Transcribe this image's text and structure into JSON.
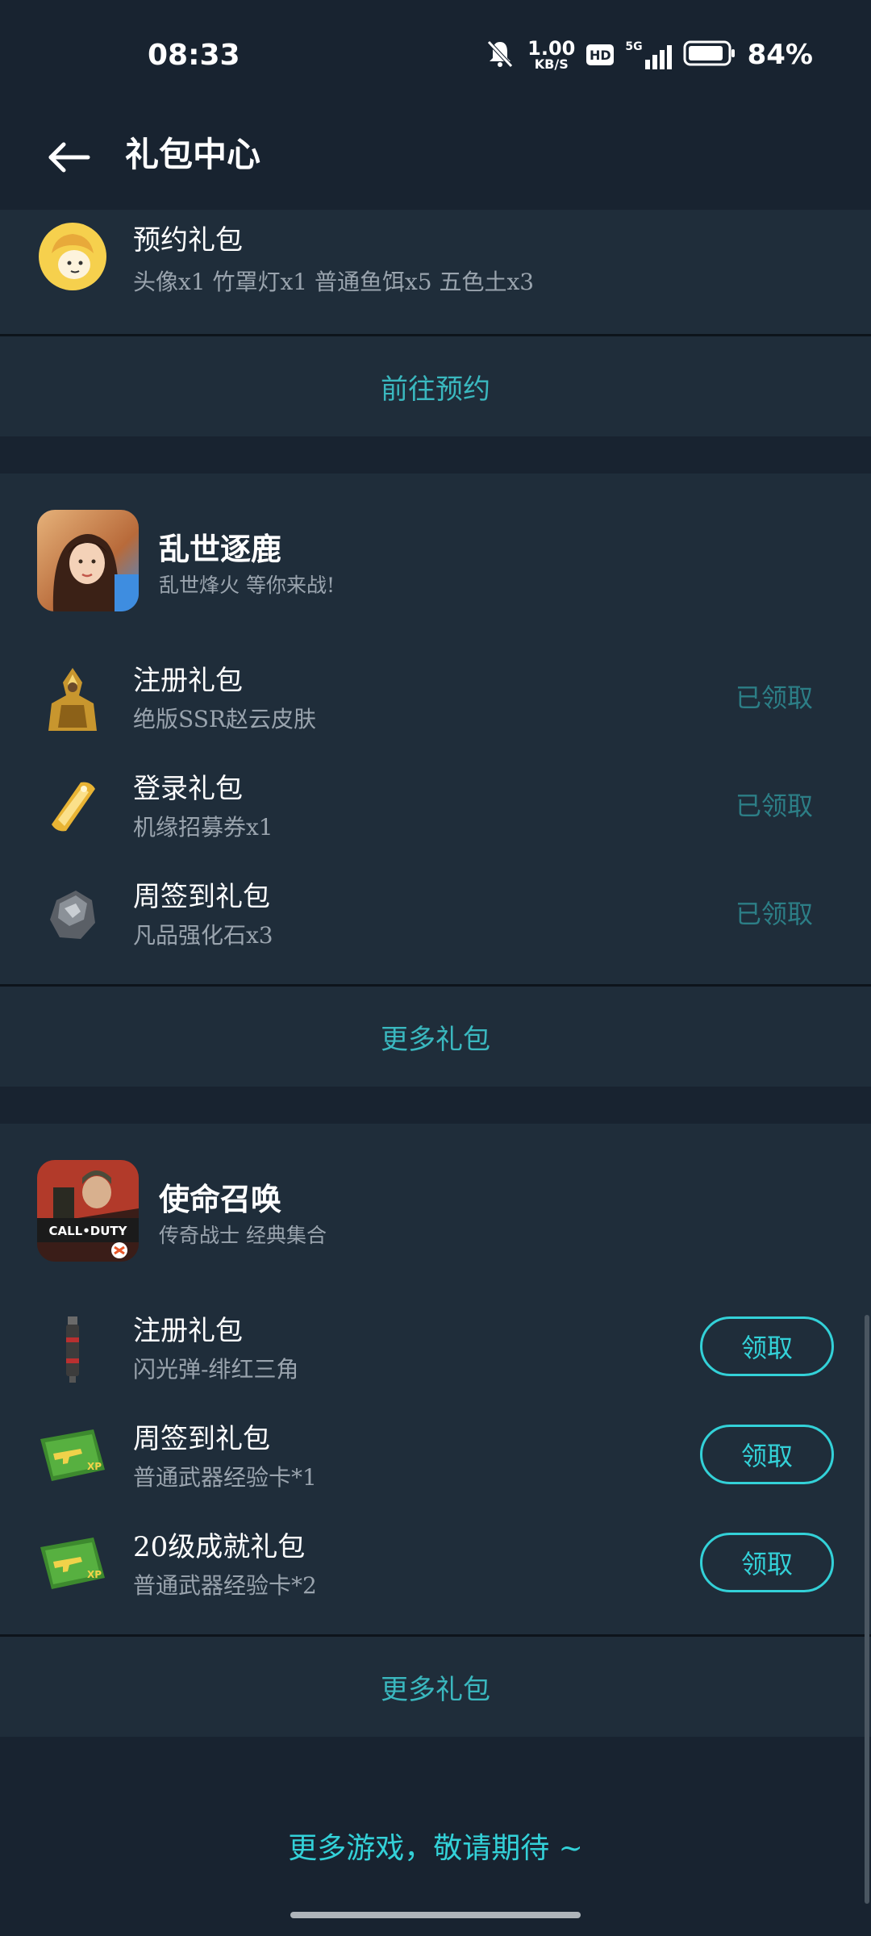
{
  "status_bar": {
    "time": "08:33",
    "net_speed_value": "1.00",
    "net_speed_unit": "KB/S",
    "hd_label": "HD",
    "network": "5G",
    "battery": "84%"
  },
  "app_bar": {
    "title": "礼包中心",
    "back_icon": "arrow-left-icon"
  },
  "reservation_card": {
    "title": "预约礼包",
    "desc": "头像x1 竹罩灯x1 普通鱼饵x5 五色土x3",
    "footer": "前往预约"
  },
  "games": [
    {
      "name": "乱世逐鹿",
      "desc": "乱世烽火 等你来战!",
      "gifts": [
        {
          "title": "注册礼包",
          "desc": "绝版SSR赵云皮肤",
          "status": "已领取"
        },
        {
          "title": "登录礼包",
          "desc": "机缘招募券x1",
          "status": "已领取"
        },
        {
          "title": "周签到礼包",
          "desc": "凡品强化石x3",
          "status": "已领取"
        }
      ],
      "footer": "更多礼包"
    },
    {
      "name": "使命召唤",
      "desc": "传奇战士 经典集合",
      "icon_text": "CALL•DUTY",
      "gifts": [
        {
          "title": "注册礼包",
          "desc": "闪光弹-绯红三角",
          "status": "领取"
        },
        {
          "title": "周签到礼包",
          "desc": "普通武器经验卡*1",
          "status": "领取"
        },
        {
          "title": "20级成就礼包",
          "desc": "普通武器经验卡*2",
          "status": "领取"
        }
      ],
      "footer": "更多礼包"
    }
  ],
  "more_games": "更多游戏，敬请期待 ~",
  "colors": {
    "background": "#182330",
    "card": "#1f2d3a",
    "accent": "#33d1d8",
    "claimed": "#2c7e86"
  }
}
